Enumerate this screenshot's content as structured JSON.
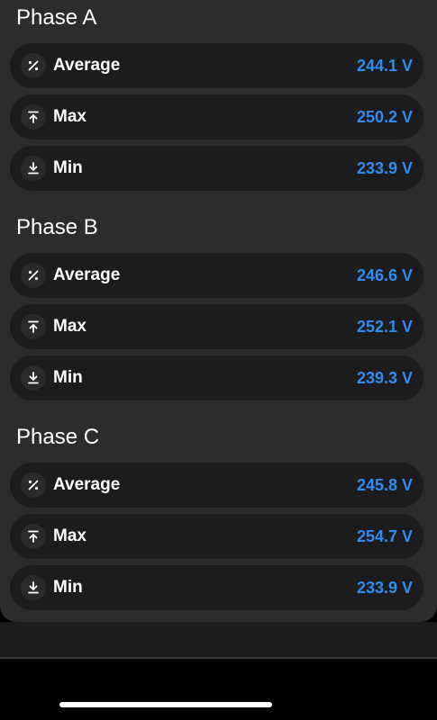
{
  "phases": [
    {
      "title": "Phase A",
      "rows": [
        {
          "icon": "percent-icon",
          "label": "Average",
          "value": "244.1 V"
        },
        {
          "icon": "arrow-up-bar-icon",
          "label": "Max",
          "value": "250.2 V"
        },
        {
          "icon": "arrow-down-bar-icon",
          "label": "Min",
          "value": "233.9 V"
        }
      ]
    },
    {
      "title": "Phase B",
      "rows": [
        {
          "icon": "percent-icon",
          "label": "Average",
          "value": "246.6 V"
        },
        {
          "icon": "arrow-up-bar-icon",
          "label": "Max",
          "value": "252.1 V"
        },
        {
          "icon": "arrow-down-bar-icon",
          "label": "Min",
          "value": "239.3 V"
        }
      ]
    },
    {
      "title": "Phase C",
      "rows": [
        {
          "icon": "percent-icon",
          "label": "Average",
          "value": "245.8 V"
        },
        {
          "icon": "arrow-up-bar-icon",
          "label": "Max",
          "value": "254.7 V"
        },
        {
          "icon": "arrow-down-bar-icon",
          "label": "Min",
          "value": "233.9 V"
        }
      ]
    }
  ],
  "colors": {
    "value": "#2f8cf0",
    "card_background": "#2c2c2e",
    "row_background": "#1c1c1e"
  }
}
